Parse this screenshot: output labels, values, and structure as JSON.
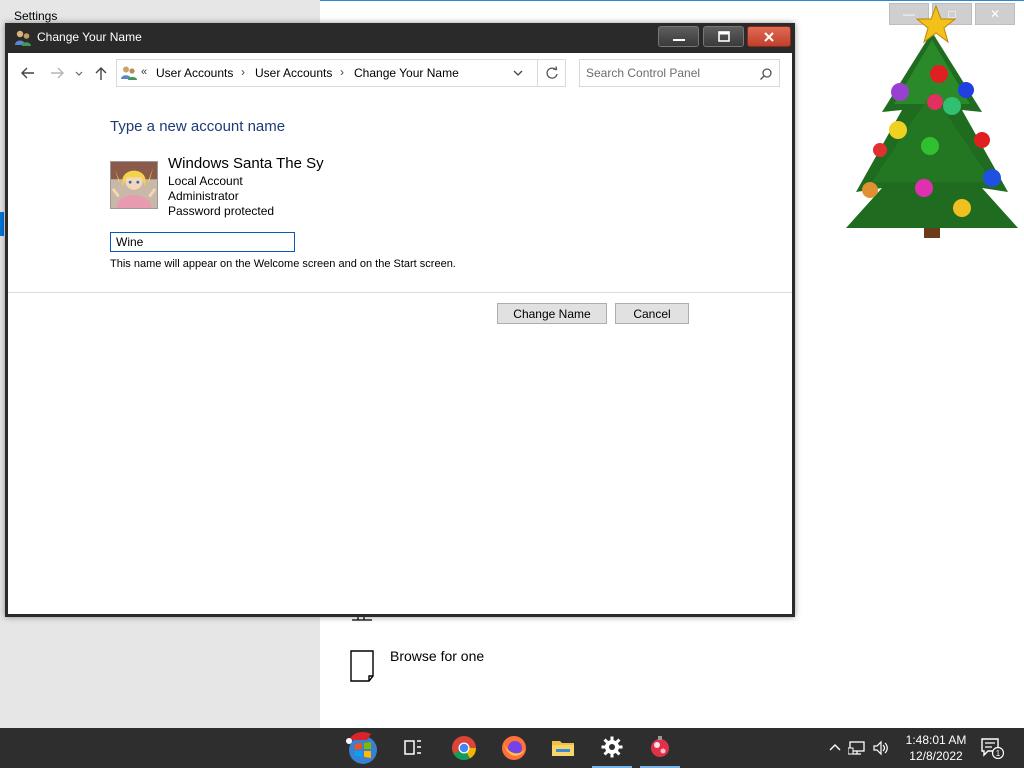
{
  "background_window": {
    "title": "Settings",
    "browse_label": "Browse for one"
  },
  "dialog": {
    "title": "Change Your Name",
    "breadcrumbs": [
      "User Accounts",
      "User Accounts",
      "Change Your Name"
    ],
    "search_placeholder": "Search Control Panel",
    "heading": "Type a new account name",
    "account": {
      "name": "Windows Santa The Sy",
      "type": "Local Account",
      "role": "Administrator",
      "password_status": "Password protected"
    },
    "new_name_value": "Wine",
    "hint": "This name will appear on the Welcome screen and on the Start screen.",
    "buttons": {
      "change": "Change Name",
      "cancel": "Cancel"
    }
  },
  "taskbar": {
    "apps": [
      "start-orb",
      "task-view",
      "chrome",
      "firefox",
      "file-explorer",
      "settings",
      "ornament-app"
    ],
    "time": "1:48:01 AM",
    "date": "12/8/2022",
    "notification_count": "1"
  },
  "colors": {
    "accent": "#0078d7",
    "heading": "#1e3a78",
    "title_bar": "#2a2a2a",
    "close_button": "#c8412c"
  }
}
